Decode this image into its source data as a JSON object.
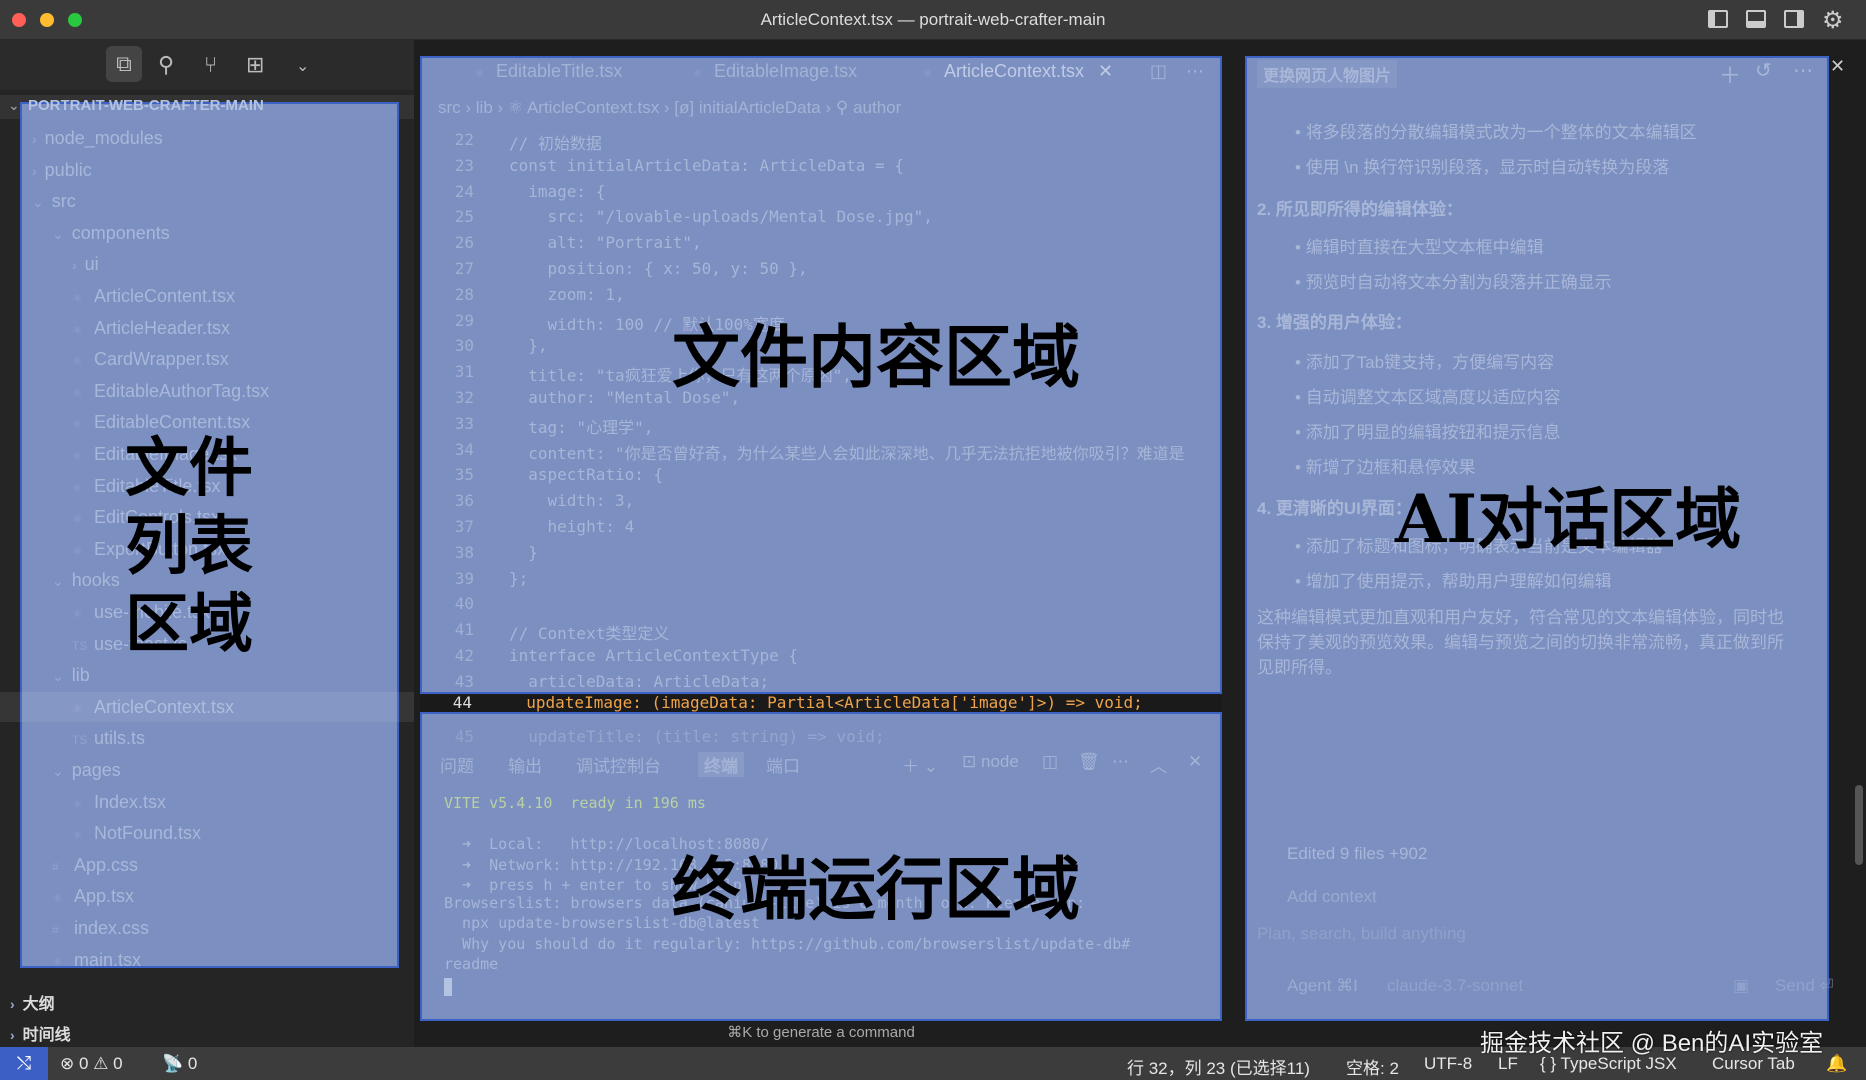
{
  "window": {
    "title": "ArticleContext.tsx — portrait-web-crafter-main"
  },
  "sidebar": {
    "project": "PORTRAIT-WEB-CRAFTER-MAIN",
    "items": [
      {
        "label": "node_modules",
        "type": "folder",
        "open": false,
        "depth": 0
      },
      {
        "label": "public",
        "type": "folder",
        "open": false,
        "depth": 0
      },
      {
        "label": "src",
        "type": "folder",
        "open": true,
        "depth": 0
      },
      {
        "label": "components",
        "type": "folder",
        "open": true,
        "depth": 1
      },
      {
        "label": "ui",
        "type": "folder",
        "open": false,
        "depth": 2
      },
      {
        "label": "ArticleContent.tsx",
        "type": "tsx",
        "depth": 2
      },
      {
        "label": "ArticleHeader.tsx",
        "type": "tsx",
        "depth": 2
      },
      {
        "label": "CardWrapper.tsx",
        "type": "tsx",
        "depth": 2
      },
      {
        "label": "EditableAuthorTag.tsx",
        "type": "tsx",
        "depth": 2
      },
      {
        "label": "EditableContent.tsx",
        "type": "tsx",
        "depth": 2
      },
      {
        "label": "EditableImage.tsx",
        "type": "tsx",
        "depth": 2
      },
      {
        "label": "EditableTitle.tsx",
        "type": "tsx",
        "depth": 2
      },
      {
        "label": "EditControls.tsx",
        "type": "tsx",
        "depth": 2
      },
      {
        "label": "ExportButton.tsx",
        "type": "tsx",
        "depth": 2
      },
      {
        "label": "hooks",
        "type": "folder",
        "open": true,
        "depth": 1
      },
      {
        "label": "use-mobile.tsx",
        "type": "tsx",
        "depth": 2
      },
      {
        "label": "use-toast.ts",
        "type": "ts",
        "depth": 2
      },
      {
        "label": "lib",
        "type": "folder",
        "open": true,
        "depth": 1
      },
      {
        "label": "ArticleContext.tsx",
        "type": "tsx",
        "depth": 2,
        "selected": true
      },
      {
        "label": "utils.ts",
        "type": "ts",
        "depth": 2
      },
      {
        "label": "pages",
        "type": "folder",
        "open": true,
        "depth": 1
      },
      {
        "label": "Index.tsx",
        "type": "tsx",
        "depth": 2
      },
      {
        "label": "NotFound.tsx",
        "type": "tsx",
        "depth": 2
      },
      {
        "label": "App.css",
        "type": "css",
        "depth": 1
      },
      {
        "label": "App.tsx",
        "type": "tsx",
        "depth": 1
      },
      {
        "label": "index.css",
        "type": "css",
        "depth": 1
      },
      {
        "label": "main.tsx",
        "type": "tsx",
        "depth": 1
      }
    ],
    "sections": [
      "大纲",
      "时间线"
    ],
    "overlay_label": [
      "文件",
      "列表",
      "区域"
    ]
  },
  "editor": {
    "tabs": [
      "EditableTitle.tsx",
      "EditableImage.tsx",
      "ArticleContext.tsx"
    ],
    "active_tab": 2,
    "breadcrumb": [
      "src",
      "lib",
      "ArticleContext.tsx",
      "initialArticleData",
      "author"
    ],
    "lines": [
      {
        "n": "22",
        "code": "// 初始数据"
      },
      {
        "n": "23",
        "code": "const initialArticleData: ArticleData = {"
      },
      {
        "n": "24",
        "code": "  image: {"
      },
      {
        "n": "25",
        "code": "    src: \"/lovable-uploads/Mental Dose.jpg\","
      },
      {
        "n": "26",
        "code": "    alt: \"Portrait\","
      },
      {
        "n": "27",
        "code": "    position: { x: 50, y: 50 },"
      },
      {
        "n": "28",
        "code": "    zoom: 1,"
      },
      {
        "n": "29",
        "code": "    width: 100 // 默认100%宽度"
      },
      {
        "n": "30",
        "code": "  },"
      },
      {
        "n": "31",
        "code": "  title: \"ta疯狂爱上你，只有这两个原因\","
      },
      {
        "n": "32",
        "code": "  author: \"Mental Dose\","
      },
      {
        "n": "33",
        "code": "  tag: \"心理学\","
      },
      {
        "n": "34",
        "code": "  content: \"你是否曾好奇，为什么某些人会如此深深地、几乎无法抗拒地被你吸引？难道是"
      },
      {
        "n": "35",
        "code": "  aspectRatio: {"
      },
      {
        "n": "36",
        "code": "    width: 3,"
      },
      {
        "n": "37",
        "code": "    height: 4"
      },
      {
        "n": "38",
        "code": "  }"
      },
      {
        "n": "39",
        "code": "};"
      },
      {
        "n": "40",
        "code": ""
      },
      {
        "n": "41",
        "code": "// Context类型定义"
      },
      {
        "n": "42",
        "code": "interface ArticleContextType {"
      },
      {
        "n": "43",
        "code": "  articleData: ArticleData;"
      }
    ],
    "current_line": {
      "n": "44",
      "code": "  updateImage: (imageData: Partial<ArticleData['image']>) => void;"
    },
    "next_line": {
      "n": "45",
      "code": "  updateTitle: (title: string) => void;"
    },
    "overlay_label": "文件内容区域"
  },
  "terminal": {
    "tabs": [
      "问题",
      "输出",
      "调试控制台",
      "终端",
      "端口"
    ],
    "active_tab": 3,
    "shell": "node",
    "lines": [
      "VITE v5.4.10  ready in 196 ms",
      "",
      "  ➜  Local:   http://localhost:8080/",
      "  ➜  Network: http://192.168.1.5:8080/",
      "  ➜  press h + enter to show help",
      "Browserslist: browsers data (caniuse-lite) is 6 months old. Please run:",
      "  npx update-browserslist-db@latest",
      "  Why you should do it regularly: https://github.com/browserslist/update-db#",
      "readme"
    ],
    "hint": "⌘K to generate a command",
    "overlay_label": "终端运行区域"
  },
  "chat": {
    "title": "更换网页人物图片",
    "content": [
      {
        "kind": "bullet",
        "text": "将多段落的分散编辑模式改为一个整体的文本编辑区"
      },
      {
        "kind": "bullet",
        "text": "使用 \\n 换行符识别段落，显示时自动转换为段落"
      },
      {
        "kind": "heading",
        "text": "2. 所见即所得的编辑体验："
      },
      {
        "kind": "bullet",
        "text": "编辑时直接在大型文本框中编辑"
      },
      {
        "kind": "bullet",
        "text": "预览时自动将文本分割为段落并正确显示"
      },
      {
        "kind": "heading",
        "text": "3. 增强的用户体验："
      },
      {
        "kind": "bullet",
        "text": "添加了Tab键支持，方便编写内容"
      },
      {
        "kind": "bullet",
        "text": "自动调整文本区域高度以适应内容"
      },
      {
        "kind": "bullet",
        "text": "添加了明显的编辑按钮和提示信息"
      },
      {
        "kind": "bullet",
        "text": "新增了边框和悬停效果"
      },
      {
        "kind": "heading",
        "text": "4. 更清晰的UI界面："
      },
      {
        "kind": "bullet",
        "text": "添加了标题和图标，明确表示当前是文本编辑器"
      },
      {
        "kind": "bullet",
        "text": "增加了使用提示，帮助用户理解如何编辑"
      },
      {
        "kind": "para",
        "text": "这种编辑模式更加直观和用户友好，符合常见的文本编辑体验，同时也"
      },
      {
        "kind": "para",
        "text": "保持了美观的预览效果。编辑与预览之间的切换非常流畅，真正做到所"
      },
      {
        "kind": "para",
        "text": "见即所得。"
      }
    ],
    "edited": "Edited 9 files +902",
    "add_context": "Add context",
    "placeholder": "Plan, search, build anything",
    "mode": "Agent ⌘I",
    "model": "claude-3.7-sonnet",
    "send": "Send ⏎",
    "overlay_label": "AI对话区域"
  },
  "status": {
    "errors": "0",
    "warnings": "0",
    "ports": "0",
    "position": "行 32，列 23 (已选择11)",
    "spaces": "空格: 2",
    "encoding": "UTF-8",
    "eol": "LF",
    "language": "TypeScript JSX",
    "cursor_tab": "Cursor Tab"
  },
  "watermark": "掘金技术社区 @ Ben的AI实验室",
  "colors": {
    "overlay": "#8298cc",
    "overlay_border": "#3b62c4",
    "status_remote": "#3b5fc4"
  }
}
